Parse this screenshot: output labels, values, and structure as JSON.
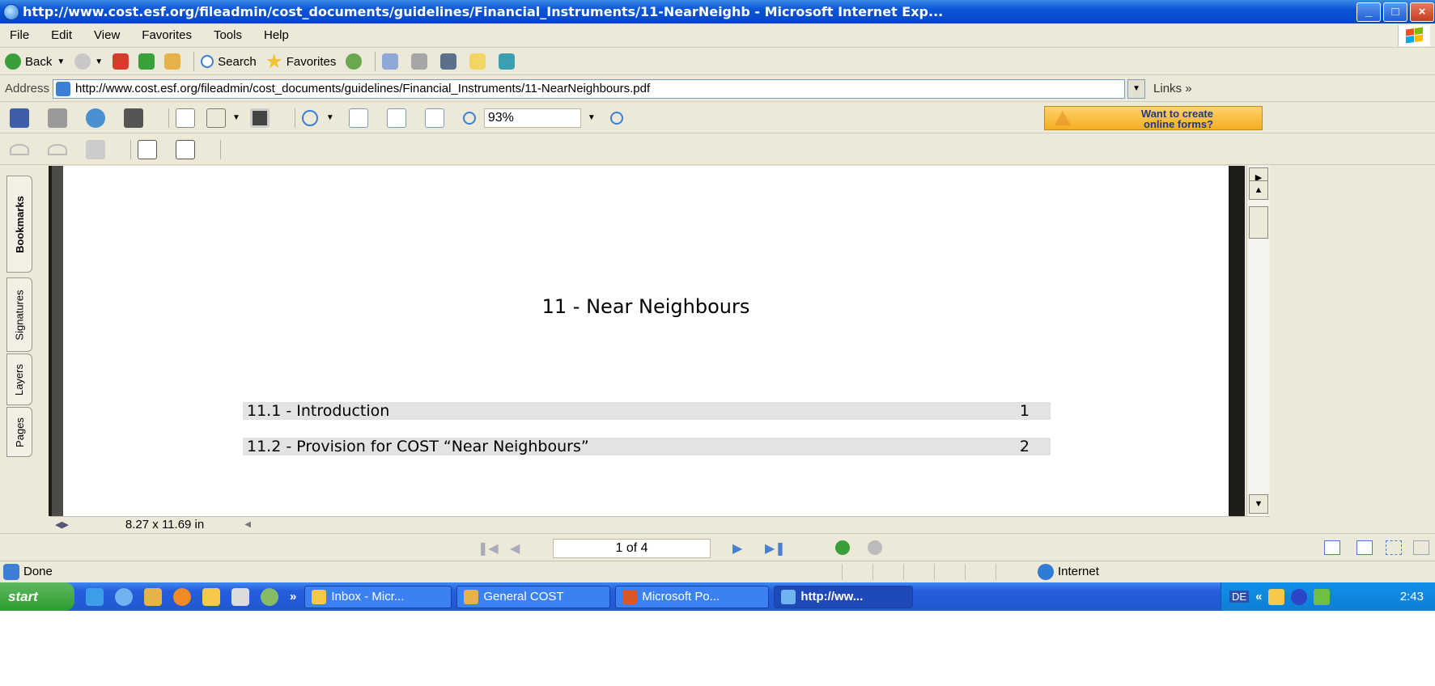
{
  "window": {
    "title": "http://www.cost.esf.org/fileadmin/cost_documents/guidelines/Financial_Instruments/11-NearNeighb - Microsoft Internet Exp...",
    "buttons": [
      "_",
      "□",
      "×"
    ]
  },
  "menu": [
    "File",
    "Edit",
    "View",
    "Favorites",
    "Tools",
    "Help"
  ],
  "toolbar": {
    "back_label": "Back",
    "search_label": "Search",
    "favorites_label": "Favorites"
  },
  "address": {
    "label": "Address",
    "url": "http://www.cost.esf.org/fileadmin/cost_documents/guidelines/Financial_Instruments/11-NearNeighbours.pdf",
    "links_label": "Links",
    "links_chevron": "»"
  },
  "acrobat": {
    "zoom": "93%",
    "promo_line1": "Want to create",
    "promo_line2": "online forms?"
  },
  "nav_tabs": [
    "Bookmarks",
    "Signatures",
    "Layers",
    "Pages"
  ],
  "document": {
    "title": "11 - Near Neighbours",
    "toc": [
      {
        "label": "11.1 - Introduction",
        "page": "1"
      },
      {
        "label": "11.2 - Provision for COST “Near Neighbours”",
        "page": "2"
      }
    ],
    "page_size": "8.27 x 11.69 in",
    "page_indicator": "1 of 4"
  },
  "status": {
    "text": "Done",
    "zone": "Internet"
  },
  "taskbar": {
    "start_label": "start",
    "chevron": "»",
    "tasks": [
      {
        "label": "Inbox - Micr..."
      },
      {
        "label": "General COST"
      },
      {
        "label": "Microsoft Po..."
      },
      {
        "label": "http://ww..."
      }
    ],
    "lang": "DE",
    "tray_chevron": "«",
    "clock": "2:43"
  },
  "colors": {
    "xp_blue": "#0a55d8",
    "chrome": "#ece9d8",
    "promo": "#f4ae20"
  }
}
